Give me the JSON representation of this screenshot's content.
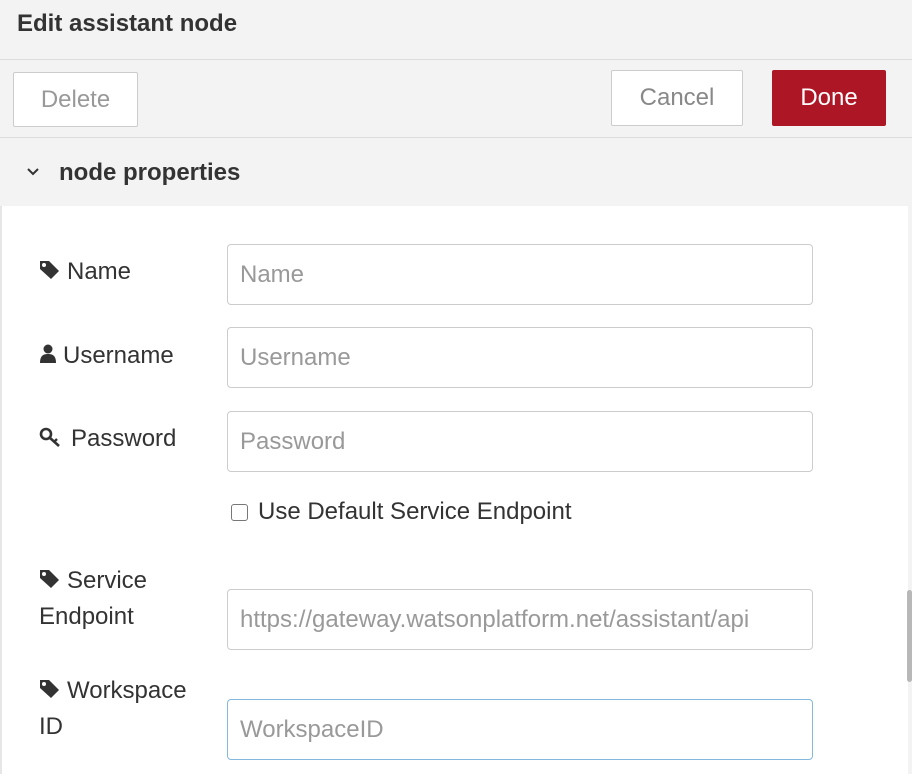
{
  "tray": {
    "title": "Edit assistant node",
    "buttons": {
      "delete": "Delete",
      "cancel": "Cancel",
      "done": "Done"
    }
  },
  "section": {
    "title": "node properties"
  },
  "form": {
    "name": {
      "label": "Name",
      "placeholder": "Name",
      "icon": "tag-icon"
    },
    "username": {
      "label": "Username",
      "placeholder": "Username",
      "icon": "user-icon"
    },
    "password": {
      "label": "Password",
      "placeholder": "Password",
      "icon": "key-icon"
    },
    "default_endpoint": {
      "label": "Use Default Service Endpoint",
      "checked": false
    },
    "service_endpoint": {
      "label_line1": "Service",
      "label_line2": "Endpoint",
      "value": "https://gateway.watsonplatform.net/assistant/api",
      "icon": "tag-icon"
    },
    "workspace_id": {
      "label_line1": "Workspace",
      "label_line2": "ID",
      "placeholder": "WorkspaceID",
      "icon": "tag-icon"
    }
  },
  "colors": {
    "done_button": "#ad1625",
    "focus_border": "#85b8dc"
  }
}
